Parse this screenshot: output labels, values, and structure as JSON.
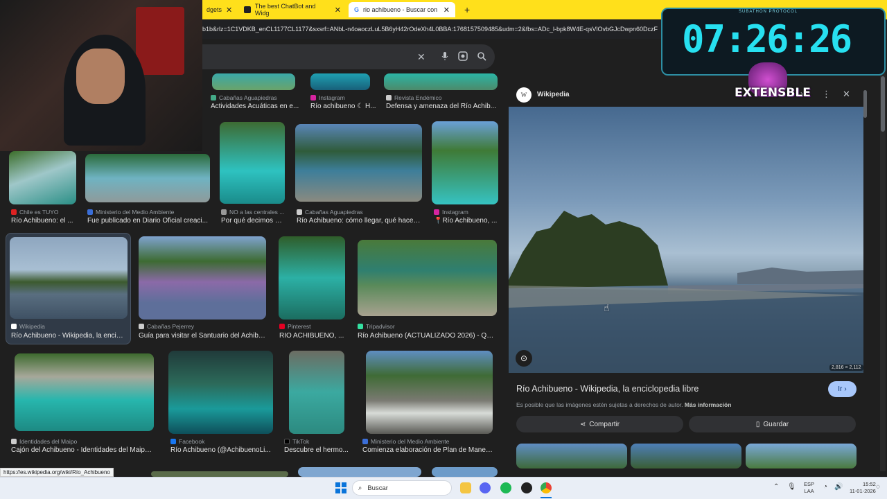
{
  "tabs": [
    {
      "label": "dgets"
    },
    {
      "label": "The best ChatBot and Widg"
    },
    {
      "label": "rio achibueno - Buscar con Goo"
    }
  ],
  "address": "b1b&rlz=1C1VDKB_enCL1177CL1177&sxsrf=ANbL-n4oaoczLuL5B6yH42rOdeXh4L0BBA:1768157509485&udm=2&fbs=ADc_l-bpk8W4E-qsVlOvbGJcDwpn60DczF",
  "results": {
    "row0": [
      {
        "source": "Cabañas Aguapiedras",
        "title": "Actividades Acuáticas en e..."
      },
      {
        "source": "Instagram",
        "title": "Río achibueno ☾ H..."
      },
      {
        "source": "Revista Endémico",
        "title": "Defensa y amenaza del Río Achib..."
      }
    ],
    "row1": [
      {
        "source": "Chile es TUYO",
        "title": "Río Achibueno: el ..."
      },
      {
        "source": "Ministerio del Medio Ambiente",
        "title": "Fue publicado en Diario Oficial creaci..."
      },
      {
        "source": "NO a las centrales ...",
        "title": "Por qué decimos N..."
      },
      {
        "source": "Cabañas Aguapiedras",
        "title": "Río Achibueno: cómo llegar, qué hacer,..."
      },
      {
        "source": "Instagram",
        "title": "📍Río Achibueno, ..."
      }
    ],
    "row2": [
      {
        "source": "Wikipedia",
        "title": "Río Achibueno - Wikipedia, la encicl..."
      },
      {
        "source": "Cabañas Pejerrey",
        "title": "Guía para visitar el Santuario del Achibu..."
      },
      {
        "source": "Pinterest",
        "title": "RIO ACHIBUENO, ..."
      },
      {
        "source": "Tripadvisor",
        "title": "Río Achibueno (ACTUALIZADO 2026) - Qué..."
      }
    ],
    "row3": [
      {
        "source": "Identidades del Maipo",
        "title": "Cajón del Achibueno - Identidades del Maipo T..."
      },
      {
        "source": "Facebook",
        "title": "Río Achibueno (@AchibuenoLi..."
      },
      {
        "source": "TikTok",
        "title": "Descubre el hermo..."
      },
      {
        "source": "Ministerio del Medio Ambiente",
        "title": "Comienza elaboración de Plan de Manejo ..."
      }
    ]
  },
  "panel": {
    "source": "Wikipedia",
    "source_letter": "W",
    "dimensions": "2,816 × 2,112",
    "title": "Río Achibueno - Wikipedia, la enciclopedia libre",
    "visit_label": "Ir",
    "copyright_note": "Es posible que las imágenes estén sujetas a derechos de autor.",
    "more_info": "Más información",
    "share_label": "Compartir",
    "save_label": "Guardar"
  },
  "overlay": {
    "timer": "07:26:26",
    "protocol": "SUBATHON PROTOCOL",
    "brand": "EXTENSBLE"
  },
  "status_url": "https://es.wikipedia.org/wiki/Río_Achibueno",
  "taskbar": {
    "search_placeholder": "Buscar",
    "lang": "ESP",
    "lang2": "LAA",
    "time": "15:52",
    "date": "11-01-2026"
  },
  "icons": [
    "close-icon",
    "mic-icon",
    "lens-icon",
    "search-icon",
    "more-icon",
    "share-icon",
    "bookmark-icon",
    "windows-icon",
    "wifi-icon",
    "volume-icon"
  ]
}
